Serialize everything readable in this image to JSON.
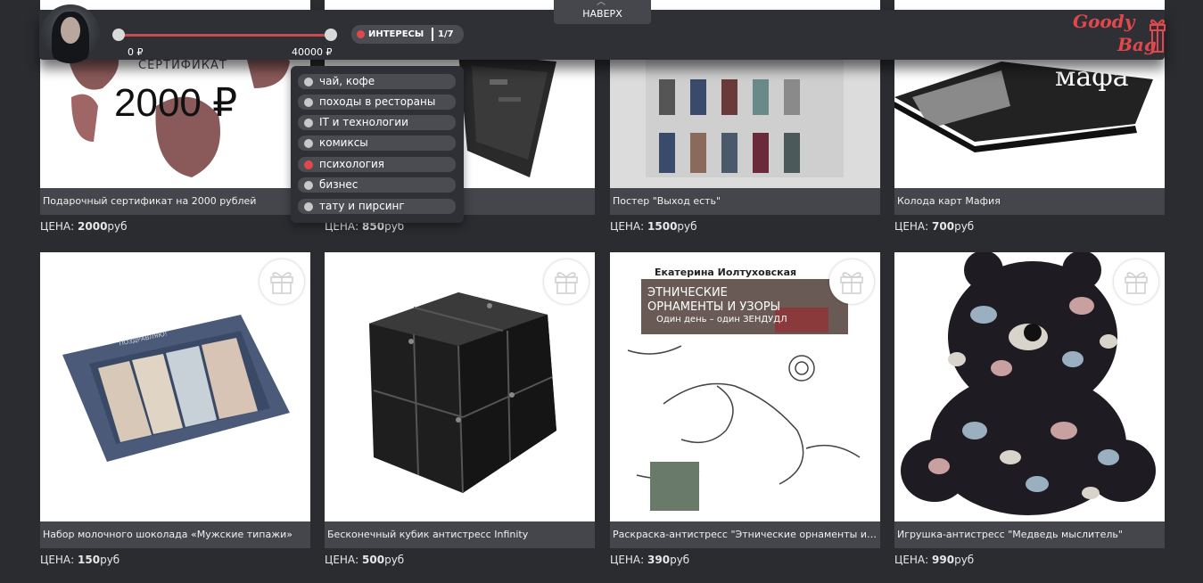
{
  "header": {
    "range_min": "0 ₽",
    "range_max": "40000 ₽",
    "interests_label": "ИНТЕРЕСЫ",
    "interests_count": "1/7",
    "scroll_top_label": "НАВЕРХ",
    "logo_line1": "Goody",
    "logo_line2": "Bag"
  },
  "interests": [
    {
      "label": "чай, кофе",
      "selected": false
    },
    {
      "label": "походы в рестораны",
      "selected": false
    },
    {
      "label": "IT и технологии",
      "selected": false
    },
    {
      "label": "комиксы",
      "selected": false
    },
    {
      "label": "психология",
      "selected": true
    },
    {
      "label": "бизнес",
      "selected": false
    },
    {
      "label": "тату и пирсинг",
      "selected": false
    }
  ],
  "price_prefix": "ЦЕНА:",
  "currency": "руб",
  "products": [
    {
      "title": "Подарочный сертификат на 2000 рублей",
      "price": "2000",
      "image_text": "2000 ₽",
      "image_caption": "СЕРТИФИКАТ"
    },
    {
      "title": "",
      "price": "850"
    },
    {
      "title": "Постер \"Выход есть\"",
      "price": "1500"
    },
    {
      "title": "Колода карт Мафия",
      "price": "700",
      "image_text": "мафа"
    },
    {
      "title": "Набор молочного шоколада «Мужские типажи»",
      "price": "150",
      "image_text": "ПОЗДРАВЛЯЮ!"
    },
    {
      "title": "Бесконечный кубик антистресс Infinity",
      "price": "500"
    },
    {
      "title": "Раскраска-антистресс \"Этнические орнаменты и узоры\"",
      "price": "390",
      "book_author": "Екатерина Иолтуховская",
      "book_title": "ЭТНИЧЕСКИЕ ОРНАМЕНТЫ И УЗОРЫ",
      "book_subtitle": "Один день – один ЗЕНДУДЛ"
    },
    {
      "title": "Игрушка-антистресс \"Медведь мыслитель\"",
      "price": "990"
    }
  ],
  "colors": {
    "accent": "#e2484b",
    "background": "#2b2c30",
    "card_title_bg": "#44464b"
  }
}
